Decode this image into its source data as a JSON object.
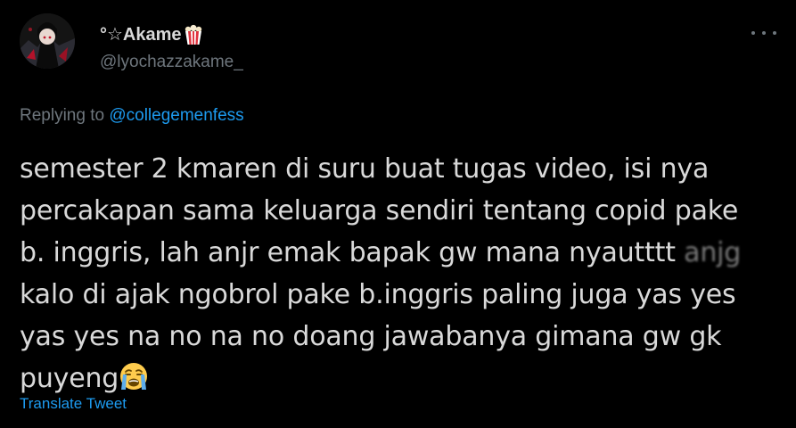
{
  "tweet": {
    "display_name": "°☆Akame",
    "name_emoji": "popcorn-emoji",
    "handle": "@lyochazzakame_",
    "replying_prefix": "Replying to",
    "replying_to": "@collegemenfess",
    "body_lines": [
      "semester 2 kmaren di suru buat tugas video, isi nya",
      "percakapan sama keluarga sendiri tentang copid pake",
      "b. inggris, lah anjr emak bapak gw mana nyautttt",
      "kalo di ajak ngobrol pake b.inggris paling juga yas yes",
      "yas yes na no na no doang jawabanya gimana gw gk",
      "puyeng"
    ],
    "blurred_word": "anjg",
    "end_emoji": "loudly-crying-face-emoji",
    "translate_label": "Translate Tweet",
    "more_icon": "more-options-icon"
  },
  "colors": {
    "background": "#000000",
    "text": "#d9d9d9",
    "muted": "#6e767d",
    "link": "#1d9bf0"
  }
}
